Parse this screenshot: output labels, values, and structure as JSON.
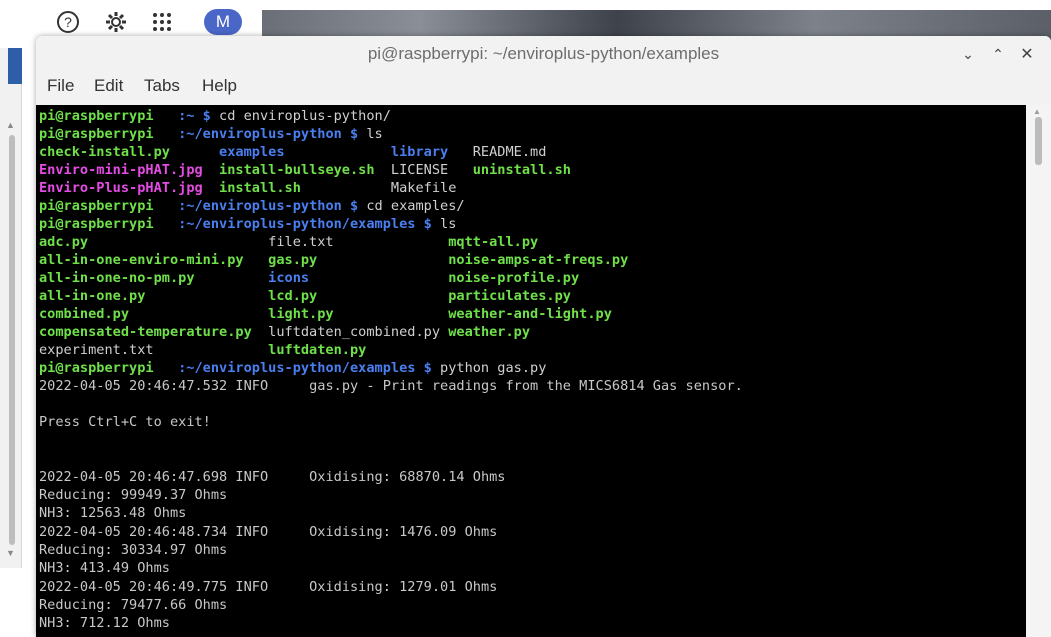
{
  "desktop": {
    "avatar_letter": "M",
    "help_icon": "help-circle-icon",
    "gear_icon": "gear-icon",
    "apps_icon": "apps-grid-icon"
  },
  "window": {
    "title": "pi@raspberrypi: ~/enviroplus-python/examples",
    "controls": {
      "minimize": "⌄",
      "maximize": "⌃",
      "close": "✕"
    }
  },
  "menu": {
    "file": "File",
    "edit": "Edit",
    "tabs": "Tabs",
    "help": "Help"
  },
  "terminal": {
    "colors": {
      "prompt": "#6fe04a",
      "path": "#4a7ff0",
      "image": "#e44ce4",
      "text": "#c8c8c8",
      "background": "#000000"
    },
    "prompt_user": "pi@raspberrypi",
    "cmd1": {
      "path": ":~ $",
      "command": " cd enviroplus-python/"
    },
    "cmd2": {
      "path": ":~/enviroplus-python $",
      "command": " ls"
    },
    "ls1": {
      "row1": [
        "check-install.py",
        "examples",
        "library",
        "README.md"
      ],
      "row2": [
        "Enviro-mini-pHAT.jpg",
        "install-bullseye.sh",
        "LICENSE",
        "uninstall.sh"
      ],
      "row3": [
        "Enviro-Plus-pHAT.jpg",
        "install.sh",
        "Makefile"
      ]
    },
    "cmd3": {
      "path": ":~/enviroplus-python $",
      "command": " cd examples/"
    },
    "cmd4": {
      "path": ":~/enviroplus-python/examples $",
      "command": " ls"
    },
    "ls2": {
      "row1": [
        "adc.py",
        "file.txt",
        "mqtt-all.py"
      ],
      "row2": [
        "all-in-one-enviro-mini.py",
        "gas.py",
        "noise-amps-at-freqs.py"
      ],
      "row3": [
        "all-in-one-no-pm.py",
        "icons",
        "noise-profile.py"
      ],
      "row4": [
        "all-in-one.py",
        "lcd.py",
        "particulates.py"
      ],
      "row5": [
        "combined.py",
        "light.py",
        "weather-and-light.py"
      ],
      "row6": [
        "compensated-temperature.py",
        "luftdaten_combined.py",
        "weather.py"
      ],
      "row7": [
        "experiment.txt",
        "luftdaten.py"
      ]
    },
    "cmd5": {
      "path": ":~/enviroplus-python/examples $",
      "command": " python gas.py"
    },
    "output": [
      "2022-04-05 20:46:47.532 INFO     gas.py - Print readings from the MICS6814 Gas sensor.",
      "",
      "Press Ctrl+C to exit!",
      "",
      "",
      "2022-04-05 20:46:47.698 INFO     Oxidising: 68870.14 Ohms",
      "Reducing: 99949.37 Ohms",
      "NH3: 12563.48 Ohms",
      "2022-04-05 20:46:48.734 INFO     Oxidising: 1476.09 Ohms",
      "Reducing: 30334.97 Ohms",
      "NH3: 413.49 Ohms",
      "2022-04-05 20:46:49.775 INFO     Oxidising: 1279.01 Ohms",
      "Reducing: 79477.66 Ohms",
      "NH3: 712.12 Ohms"
    ]
  }
}
